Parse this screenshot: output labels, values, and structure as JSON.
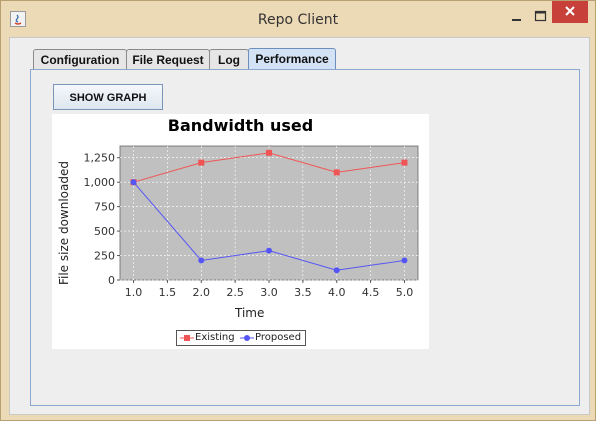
{
  "window": {
    "title": "Repo Client",
    "buttons": {
      "minimize": "–",
      "maximize": "□",
      "close": "×"
    }
  },
  "tabs": [
    {
      "label": "Configuration",
      "active": false
    },
    {
      "label": "File Request",
      "active": false
    },
    {
      "label": "Log",
      "active": false
    },
    {
      "label": "Performance",
      "active": true
    }
  ],
  "toolbar": {
    "show_graph_label": "SHOW GRAPH"
  },
  "colors": {
    "existing": "#f05555",
    "proposed": "#5555f5",
    "plot_bg": "#c0c0c0"
  },
  "chart_data": {
    "type": "line",
    "title": "Bandwidth used",
    "xlabel": "Time",
    "ylabel": "File size downloaded",
    "x": [
      1.0,
      2.0,
      3.0,
      4.0,
      5.0
    ],
    "xticks": [
      "1.0",
      "1.5",
      "2.0",
      "2.5",
      "3.0",
      "3.5",
      "4.0",
      "4.5",
      "5.0"
    ],
    "yticks": [
      "0",
      "250",
      "500",
      "750",
      "1,000",
      "1,250"
    ],
    "xlim": [
      0.8,
      5.2
    ],
    "ylim": [
      0,
      1370
    ],
    "grid": true,
    "legend_position": "bottom",
    "series": [
      {
        "name": "Existing",
        "marker": "square",
        "values": [
          1000,
          1200,
          1300,
          1100,
          1200
        ]
      },
      {
        "name": "Proposed",
        "marker": "circle",
        "values": [
          1000,
          200,
          300,
          100,
          200
        ]
      }
    ]
  }
}
